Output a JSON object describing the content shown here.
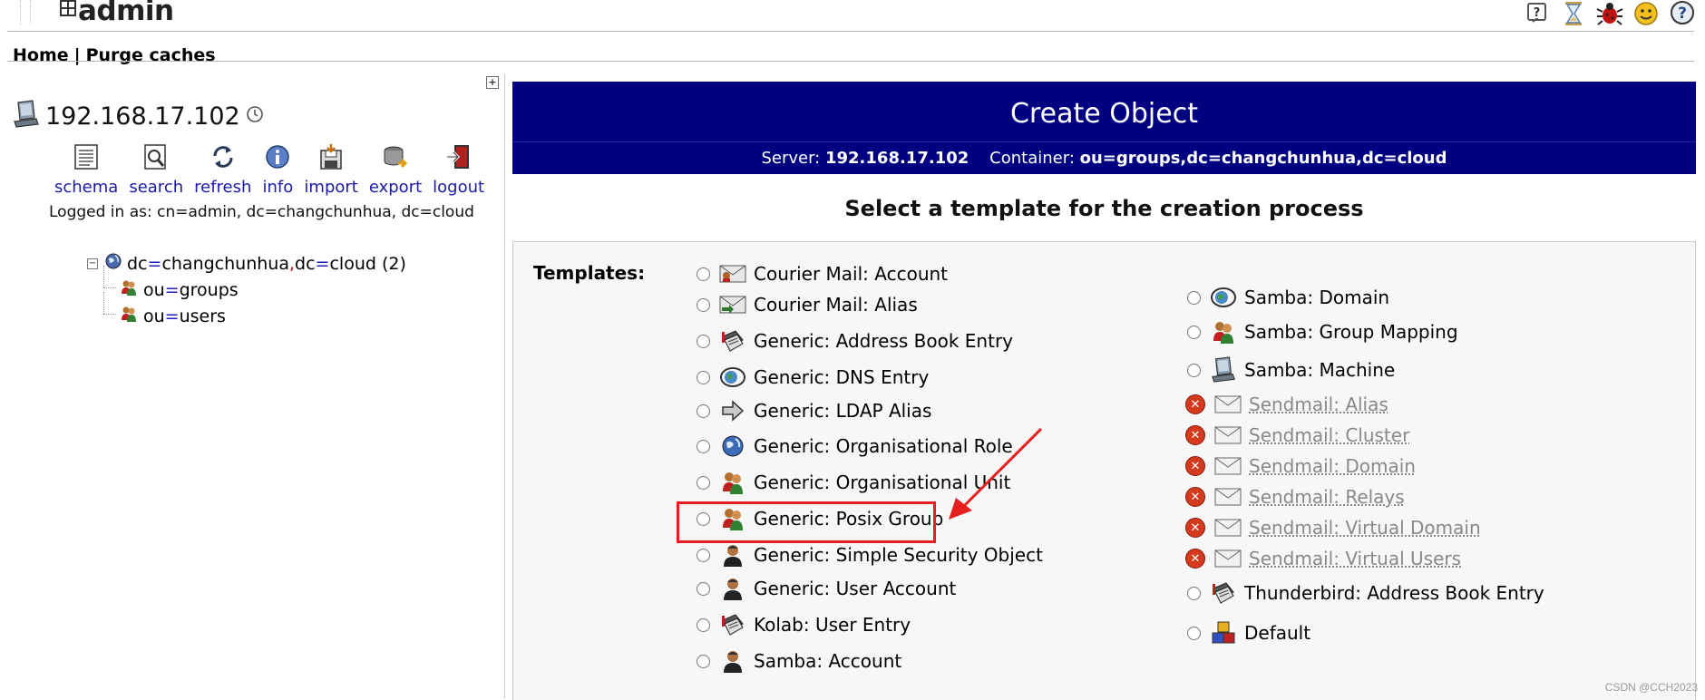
{
  "topbar": {
    "logo_text": "admin",
    "icons": [
      "help-icon",
      "hourglass-icon",
      "bug-icon",
      "smiley-icon",
      "question-bubble-icon"
    ]
  },
  "menu": {
    "home": "Home",
    "separator": "|",
    "purge": "Purge caches"
  },
  "server": {
    "name": "192.168.17.102",
    "tools": [
      {
        "label": "schema",
        "icon": "schema-icon"
      },
      {
        "label": "search",
        "icon": "search-icon"
      },
      {
        "label": "refresh",
        "icon": "refresh-icon"
      },
      {
        "label": "info",
        "icon": "info-icon"
      },
      {
        "label": "import",
        "icon": "import-icon"
      },
      {
        "label": "export",
        "icon": "export-icon"
      },
      {
        "label": "logout",
        "icon": "logout-icon"
      }
    ],
    "logged_in": "Logged in as: cn=admin, dc=changchunhua, dc=cloud"
  },
  "tree": {
    "root": {
      "k1": "dc",
      "eq1": "=",
      "v1": "changchunhua",
      "comma": ",",
      "k2": "dc",
      "eq2": "=",
      "v2": "cloud",
      "count": "(2)"
    },
    "children": [
      {
        "k": "ou",
        "eq": "=",
        "v": "groups"
      },
      {
        "k": "ou",
        "eq": "=",
        "v": "users"
      }
    ]
  },
  "create": {
    "title": "Create Object",
    "server_label": "Server:",
    "server_value": "192.168.17.102",
    "container_label": "Container:",
    "container_value": "ou=groups,dc=changchunhua,dc=cloud",
    "select_title": "Select a template for the creation process",
    "templates_label": "Templates:"
  },
  "templates_left": [
    {
      "label": "Courier Mail: Account",
      "icon": "mail-account-icon"
    },
    {
      "label": "Courier Mail: Alias",
      "icon": "mail-alias-icon"
    },
    {
      "label": "Generic: Address Book Entry",
      "icon": "address-book-icon"
    },
    {
      "label": "Generic: DNS Entry",
      "icon": "dns-icon"
    },
    {
      "label": "Generic: LDAP Alias",
      "icon": "alias-arrow-icon"
    },
    {
      "label": "Generic: Organisational Role",
      "icon": "globe-icon"
    },
    {
      "label": "Generic: Organisational Unit",
      "icon": "org-unit-icon"
    },
    {
      "label": "Generic: Posix Group",
      "icon": "group-icon"
    },
    {
      "label": "Generic: Simple Security Object",
      "icon": "user-icon"
    },
    {
      "label": "Generic: User Account",
      "icon": "user-icon"
    },
    {
      "label": "Kolab: User Entry",
      "icon": "address-book-icon"
    },
    {
      "label": "Samba: Account",
      "icon": "user-icon"
    }
  ],
  "templates_right": [
    {
      "label": "Samba: Domain",
      "icon": "dns-icon",
      "disabled": false
    },
    {
      "label": "Samba: Group Mapping",
      "icon": "group-icon",
      "disabled": false
    },
    {
      "label": "Samba: Machine",
      "icon": "computer-icon",
      "disabled": false
    },
    {
      "label": "Sendmail: Alias",
      "icon": "envelope-icon",
      "disabled": true
    },
    {
      "label": "Sendmail: Cluster",
      "icon": "envelope-icon",
      "disabled": true
    },
    {
      "label": "Sendmail: Domain",
      "icon": "envelope-icon",
      "disabled": true
    },
    {
      "label": "Sendmail: Relays",
      "icon": "envelope-icon",
      "disabled": true
    },
    {
      "label": "Sendmail: Virtual Domain",
      "icon": "envelope-icon",
      "disabled": true
    },
    {
      "label": "Sendmail: Virtual Users",
      "icon": "envelope-icon",
      "disabled": true
    },
    {
      "label": "Thunderbird: Address Book Entry",
      "icon": "address-book-icon",
      "disabled": false
    },
    {
      "label": "Default",
      "icon": "default-cubes-icon",
      "disabled": false
    }
  ],
  "colors": {
    "header_bg": "#000080",
    "link": "#1b1ba8",
    "highlight": "#e51e1e"
  },
  "watermark": "CSDN @CCH2023"
}
